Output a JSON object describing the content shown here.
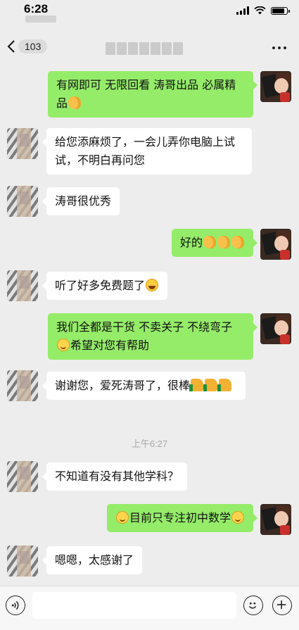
{
  "status_bar": {
    "time": "6:28",
    "battery_level": 0.9
  },
  "nav": {
    "back_count": "103",
    "title": ""
  },
  "messages": [
    {
      "from": "me",
      "parts": [
        {
          "t": "有网即可 无限回看 涛哥出品 必属精品"
        },
        {
          "emoji": "handshake-emoji"
        }
      ]
    },
    {
      "from": "other",
      "parts": [
        {
          "t": "给您添麻烦了，一会儿弄你电脑上试试，不明白再问您"
        }
      ]
    },
    {
      "from": "other",
      "parts": [
        {
          "t": "涛哥很优秀"
        }
      ]
    },
    {
      "from": "me",
      "parts": [
        {
          "t": "好的"
        },
        {
          "emoji": "handshake-emoji"
        },
        {
          "emoji": "handshake-emoji"
        },
        {
          "emoji": "handshake-emoji"
        }
      ]
    },
    {
      "from": "other",
      "parts": [
        {
          "t": "听了好多免费题了"
        },
        {
          "emoji": "laughing-emoji"
        }
      ]
    },
    {
      "from": "me",
      "parts": [
        {
          "t": "我们全都是干货  不卖关子  不绕弯子 "
        },
        {
          "emoji": "smile-emoji"
        },
        {
          "t": "希望对您有帮助"
        }
      ]
    },
    {
      "from": "other",
      "parts": [
        {
          "t": "谢谢您，爱死涛哥了，很棒"
        },
        {
          "emoji": "thumbs-up-emoji"
        },
        {
          "emoji": "thumbs-up-emoji"
        },
        {
          "emoji": "thumbs-up-emoji"
        }
      ]
    },
    {
      "from": "other",
      "parts": [
        {
          "t": "不知道有没有其他学科？"
        }
      ]
    },
    {
      "from": "me",
      "parts": [
        {
          "emoji": "smile-emoji"
        },
        {
          "t": "目前只专注初中数学"
        },
        {
          "emoji": "smile-emoji"
        }
      ]
    },
    {
      "from": "other",
      "parts": [
        {
          "t": "嗯嗯，太感谢了"
        }
      ]
    }
  ],
  "timestamp": "上午6:27",
  "input": {
    "placeholder": "",
    "value": ""
  },
  "icons": {
    "voice": "voice-icon",
    "emoji": "emoji-face-icon",
    "plus": "plus-icon",
    "back": "chevron-left-icon",
    "more": "more-dots-icon"
  },
  "colors": {
    "outgoing_bubble": "#95ec69",
    "incoming_bubble": "#ffffff",
    "background": "#ededed"
  }
}
